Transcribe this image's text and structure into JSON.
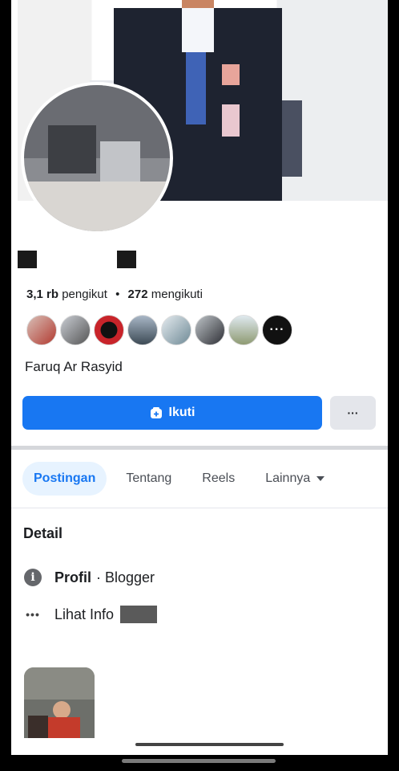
{
  "profile": {
    "followers_count": "3,1 rb",
    "followers_label": "pengikut",
    "following_count": "272",
    "following_label": "mengikuti",
    "bio": "Faruq Ar Rasyid"
  },
  "friends_more_label": "···",
  "actions": {
    "follow_label": "Ikuti",
    "more_label": "···"
  },
  "tabs": [
    {
      "label": "Postingan",
      "active": true
    },
    {
      "label": "Tentang",
      "active": false
    },
    {
      "label": "Reels",
      "active": false
    },
    {
      "label": "Lainnya",
      "active": false
    }
  ],
  "detail": {
    "title": "Detail",
    "profile_label": "Profil",
    "profile_value": "· Blogger",
    "more_info_label": "Lihat Info"
  },
  "colors": {
    "primary": "#1877f2",
    "tab_active_bg": "#e7f3ff"
  }
}
